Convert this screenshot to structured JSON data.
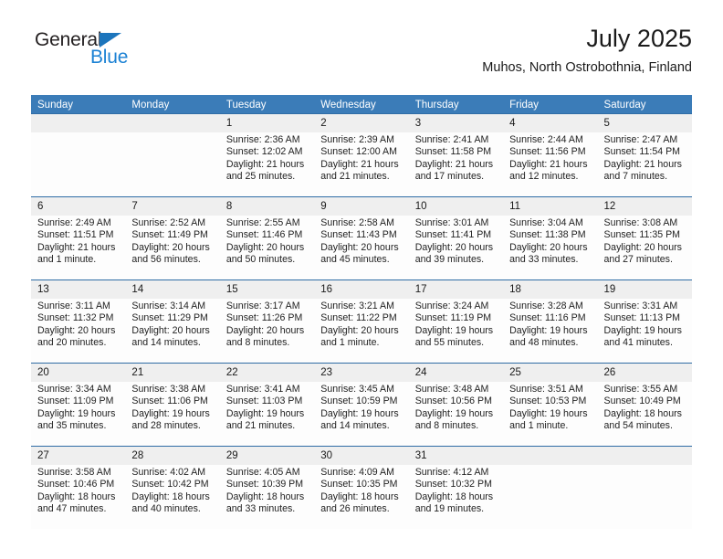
{
  "brand": {
    "name_part1": "General",
    "name_part2": "Blue",
    "triangle_color": "#1c75bc",
    "blue_color": "#1c82d4"
  },
  "header": {
    "title": "July 2025",
    "subtitle": "Muhos, North Ostrobothnia, Finland"
  },
  "theme": {
    "header_bg": "#3b7cb8",
    "header_text": "#ffffff",
    "daynum_bg": "#efefef",
    "cell_bg": "#fdfdfd",
    "separator": "#2f6ca5"
  },
  "weekdays": [
    "Sunday",
    "Monday",
    "Tuesday",
    "Wednesday",
    "Thursday",
    "Friday",
    "Saturday"
  ],
  "weeks": [
    {
      "days": [
        {
          "num": "",
          "sunrise": "",
          "sunset": "",
          "daylight_line1": "",
          "daylight_line2": "",
          "empty": true
        },
        {
          "num": "",
          "sunrise": "",
          "sunset": "",
          "daylight_line1": "",
          "daylight_line2": "",
          "empty": true
        },
        {
          "num": "1",
          "sunrise": "Sunrise: 2:36 AM",
          "sunset": "Sunset: 12:02 AM",
          "daylight_line1": "Daylight: 21 hours",
          "daylight_line2": "and 25 minutes.",
          "empty": false
        },
        {
          "num": "2",
          "sunrise": "Sunrise: 2:39 AM",
          "sunset": "Sunset: 12:00 AM",
          "daylight_line1": "Daylight: 21 hours",
          "daylight_line2": "and 21 minutes.",
          "empty": false
        },
        {
          "num": "3",
          "sunrise": "Sunrise: 2:41 AM",
          "sunset": "Sunset: 11:58 PM",
          "daylight_line1": "Daylight: 21 hours",
          "daylight_line2": "and 17 minutes.",
          "empty": false
        },
        {
          "num": "4",
          "sunrise": "Sunrise: 2:44 AM",
          "sunset": "Sunset: 11:56 PM",
          "daylight_line1": "Daylight: 21 hours",
          "daylight_line2": "and 12 minutes.",
          "empty": false
        },
        {
          "num": "5",
          "sunrise": "Sunrise: 2:47 AM",
          "sunset": "Sunset: 11:54 PM",
          "daylight_line1": "Daylight: 21 hours",
          "daylight_line2": "and 7 minutes.",
          "empty": false
        }
      ]
    },
    {
      "days": [
        {
          "num": "6",
          "sunrise": "Sunrise: 2:49 AM",
          "sunset": "Sunset: 11:51 PM",
          "daylight_line1": "Daylight: 21 hours",
          "daylight_line2": "and 1 minute.",
          "empty": false
        },
        {
          "num": "7",
          "sunrise": "Sunrise: 2:52 AM",
          "sunset": "Sunset: 11:49 PM",
          "daylight_line1": "Daylight: 20 hours",
          "daylight_line2": "and 56 minutes.",
          "empty": false
        },
        {
          "num": "8",
          "sunrise": "Sunrise: 2:55 AM",
          "sunset": "Sunset: 11:46 PM",
          "daylight_line1": "Daylight: 20 hours",
          "daylight_line2": "and 50 minutes.",
          "empty": false
        },
        {
          "num": "9",
          "sunrise": "Sunrise: 2:58 AM",
          "sunset": "Sunset: 11:43 PM",
          "daylight_line1": "Daylight: 20 hours",
          "daylight_line2": "and 45 minutes.",
          "empty": false
        },
        {
          "num": "10",
          "sunrise": "Sunrise: 3:01 AM",
          "sunset": "Sunset: 11:41 PM",
          "daylight_line1": "Daylight: 20 hours",
          "daylight_line2": "and 39 minutes.",
          "empty": false
        },
        {
          "num": "11",
          "sunrise": "Sunrise: 3:04 AM",
          "sunset": "Sunset: 11:38 PM",
          "daylight_line1": "Daylight: 20 hours",
          "daylight_line2": "and 33 minutes.",
          "empty": false
        },
        {
          "num": "12",
          "sunrise": "Sunrise: 3:08 AM",
          "sunset": "Sunset: 11:35 PM",
          "daylight_line1": "Daylight: 20 hours",
          "daylight_line2": "and 27 minutes.",
          "empty": false
        }
      ]
    },
    {
      "days": [
        {
          "num": "13",
          "sunrise": "Sunrise: 3:11 AM",
          "sunset": "Sunset: 11:32 PM",
          "daylight_line1": "Daylight: 20 hours",
          "daylight_line2": "and 20 minutes.",
          "empty": false
        },
        {
          "num": "14",
          "sunrise": "Sunrise: 3:14 AM",
          "sunset": "Sunset: 11:29 PM",
          "daylight_line1": "Daylight: 20 hours",
          "daylight_line2": "and 14 minutes.",
          "empty": false
        },
        {
          "num": "15",
          "sunrise": "Sunrise: 3:17 AM",
          "sunset": "Sunset: 11:26 PM",
          "daylight_line1": "Daylight: 20 hours",
          "daylight_line2": "and 8 minutes.",
          "empty": false
        },
        {
          "num": "16",
          "sunrise": "Sunrise: 3:21 AM",
          "sunset": "Sunset: 11:22 PM",
          "daylight_line1": "Daylight: 20 hours",
          "daylight_line2": "and 1 minute.",
          "empty": false
        },
        {
          "num": "17",
          "sunrise": "Sunrise: 3:24 AM",
          "sunset": "Sunset: 11:19 PM",
          "daylight_line1": "Daylight: 19 hours",
          "daylight_line2": "and 55 minutes.",
          "empty": false
        },
        {
          "num": "18",
          "sunrise": "Sunrise: 3:28 AM",
          "sunset": "Sunset: 11:16 PM",
          "daylight_line1": "Daylight: 19 hours",
          "daylight_line2": "and 48 minutes.",
          "empty": false
        },
        {
          "num": "19",
          "sunrise": "Sunrise: 3:31 AM",
          "sunset": "Sunset: 11:13 PM",
          "daylight_line1": "Daylight: 19 hours",
          "daylight_line2": "and 41 minutes.",
          "empty": false
        }
      ]
    },
    {
      "days": [
        {
          "num": "20",
          "sunrise": "Sunrise: 3:34 AM",
          "sunset": "Sunset: 11:09 PM",
          "daylight_line1": "Daylight: 19 hours",
          "daylight_line2": "and 35 minutes.",
          "empty": false
        },
        {
          "num": "21",
          "sunrise": "Sunrise: 3:38 AM",
          "sunset": "Sunset: 11:06 PM",
          "daylight_line1": "Daylight: 19 hours",
          "daylight_line2": "and 28 minutes.",
          "empty": false
        },
        {
          "num": "22",
          "sunrise": "Sunrise: 3:41 AM",
          "sunset": "Sunset: 11:03 PM",
          "daylight_line1": "Daylight: 19 hours",
          "daylight_line2": "and 21 minutes.",
          "empty": false
        },
        {
          "num": "23",
          "sunrise": "Sunrise: 3:45 AM",
          "sunset": "Sunset: 10:59 PM",
          "daylight_line1": "Daylight: 19 hours",
          "daylight_line2": "and 14 minutes.",
          "empty": false
        },
        {
          "num": "24",
          "sunrise": "Sunrise: 3:48 AM",
          "sunset": "Sunset: 10:56 PM",
          "daylight_line1": "Daylight: 19 hours",
          "daylight_line2": "and 8 minutes.",
          "empty": false
        },
        {
          "num": "25",
          "sunrise": "Sunrise: 3:51 AM",
          "sunset": "Sunset: 10:53 PM",
          "daylight_line1": "Daylight: 19 hours",
          "daylight_line2": "and 1 minute.",
          "empty": false
        },
        {
          "num": "26",
          "sunrise": "Sunrise: 3:55 AM",
          "sunset": "Sunset: 10:49 PM",
          "daylight_line1": "Daylight: 18 hours",
          "daylight_line2": "and 54 minutes.",
          "empty": false
        }
      ]
    },
    {
      "days": [
        {
          "num": "27",
          "sunrise": "Sunrise: 3:58 AM",
          "sunset": "Sunset: 10:46 PM",
          "daylight_line1": "Daylight: 18 hours",
          "daylight_line2": "and 47 minutes.",
          "empty": false
        },
        {
          "num": "28",
          "sunrise": "Sunrise: 4:02 AM",
          "sunset": "Sunset: 10:42 PM",
          "daylight_line1": "Daylight: 18 hours",
          "daylight_line2": "and 40 minutes.",
          "empty": false
        },
        {
          "num": "29",
          "sunrise": "Sunrise: 4:05 AM",
          "sunset": "Sunset: 10:39 PM",
          "daylight_line1": "Daylight: 18 hours",
          "daylight_line2": "and 33 minutes.",
          "empty": false
        },
        {
          "num": "30",
          "sunrise": "Sunrise: 4:09 AM",
          "sunset": "Sunset: 10:35 PM",
          "daylight_line1": "Daylight: 18 hours",
          "daylight_line2": "and 26 minutes.",
          "empty": false
        },
        {
          "num": "31",
          "sunrise": "Sunrise: 4:12 AM",
          "sunset": "Sunset: 10:32 PM",
          "daylight_line1": "Daylight: 18 hours",
          "daylight_line2": "and 19 minutes.",
          "empty": false
        },
        {
          "num": "",
          "sunrise": "",
          "sunset": "",
          "daylight_line1": "",
          "daylight_line2": "",
          "empty": true
        },
        {
          "num": "",
          "sunrise": "",
          "sunset": "",
          "daylight_line1": "",
          "daylight_line2": "",
          "empty": true
        }
      ]
    }
  ]
}
